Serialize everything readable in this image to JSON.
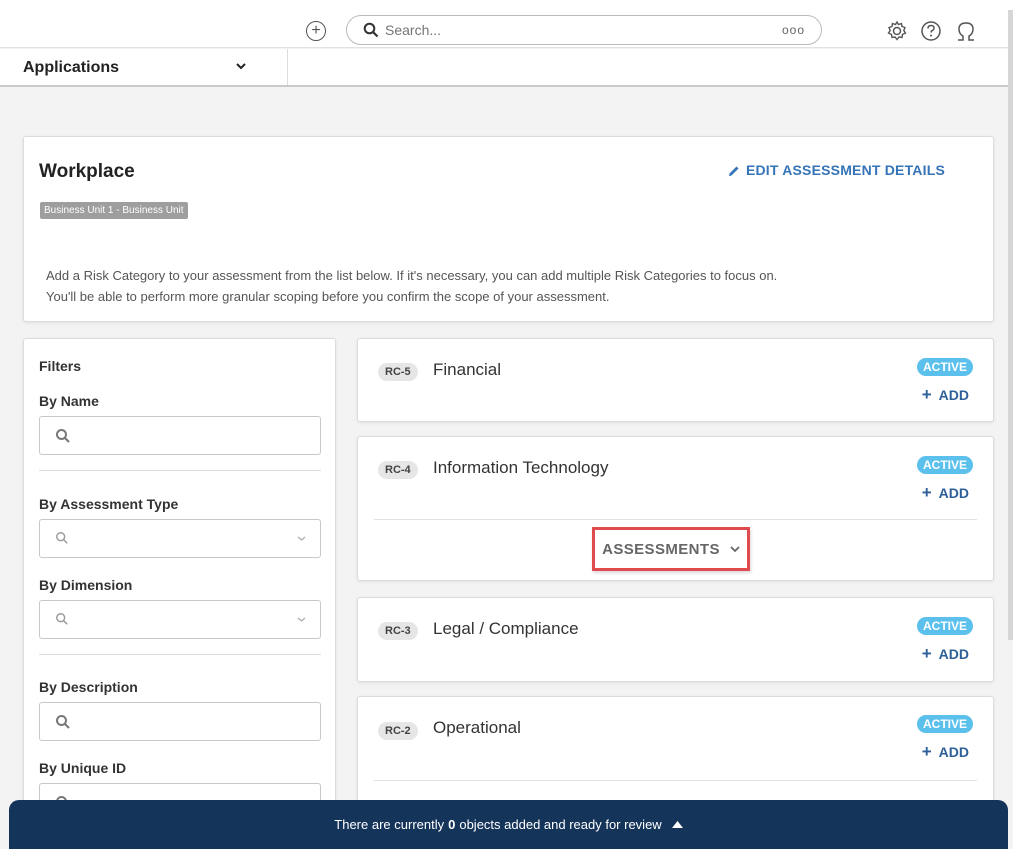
{
  "topbar": {
    "search_placeholder": "Search...",
    "search_more": "ooo",
    "icons": [
      "plus-circle-icon",
      "search-icon",
      "gear-icon",
      "help-icon",
      "user-icon"
    ]
  },
  "appbar": {
    "label": "Applications"
  },
  "workplace": {
    "title": "Workplace",
    "badge": "Business Unit 1 - Business Unit",
    "edit_label": "EDIT ASSESSMENT DETAILS",
    "desc_line1": "Add a Risk Category to your assessment from the list below. If it's necessary, you can add multiple Risk Categories to focus on.",
    "desc_line2": "You'll be able to perform more granular scoping before you confirm the scope of your assessment."
  },
  "filters": {
    "title": "Filters",
    "by_name": "By Name",
    "by_assessment_type": "By Assessment Type",
    "by_dimension": "By Dimension",
    "by_description": "By Description",
    "by_unique_id": "By Unique ID"
  },
  "categories": [
    {
      "code": "RC-5",
      "name": "Financial",
      "status": "ACTIVE",
      "add": "ADD"
    },
    {
      "code": "RC-4",
      "name": "Information Technology",
      "status": "ACTIVE",
      "add": "ADD",
      "assessments": "ASSESSMENTS"
    },
    {
      "code": "RC-3",
      "name": "Legal / Compliance",
      "status": "ACTIVE",
      "add": "ADD"
    },
    {
      "code": "RC-2",
      "name": "Operational",
      "status": "ACTIVE",
      "add": "ADD"
    }
  ],
  "review_bar": {
    "prefix": "There are currently",
    "count": "0",
    "suffix": "objects added and ready for review"
  },
  "colors": {
    "accent": "#3574b8",
    "active_badge": "#5bc0eb",
    "review_bar": "#15345a",
    "highlight": "#e04b4b"
  }
}
